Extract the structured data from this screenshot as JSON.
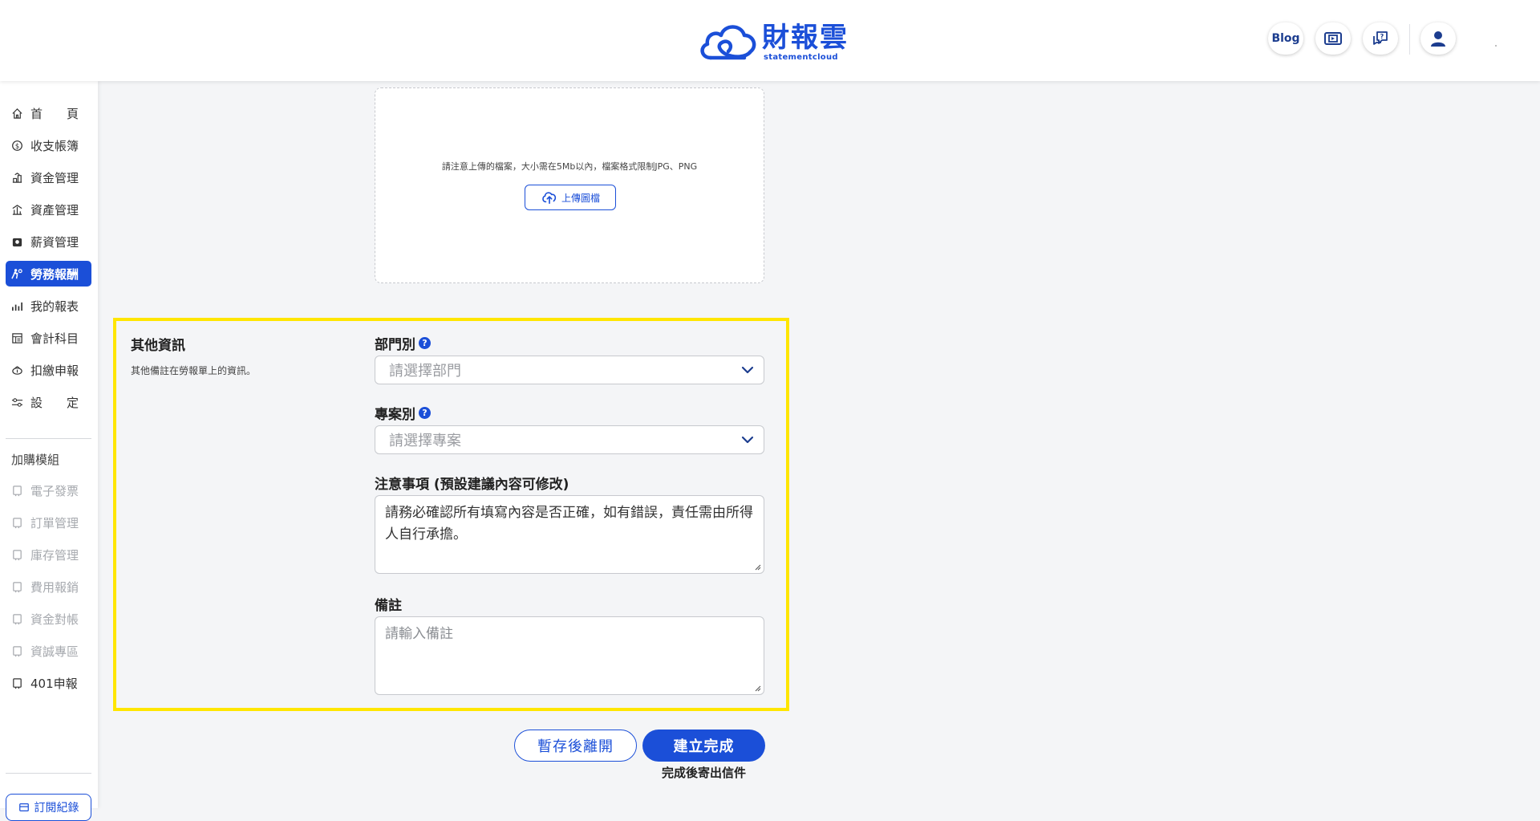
{
  "header": {
    "logo_text": "財報雲",
    "logo_sub": "statementcloud",
    "blog_label": "Blog",
    "icons": [
      "video-guide-icon",
      "help-chat-icon",
      "user-icon"
    ]
  },
  "sidebar": {
    "items": [
      {
        "label": "首　　頁",
        "icon": "home-icon"
      },
      {
        "label": "收支帳簿",
        "icon": "coin-icon"
      },
      {
        "label": "資金管理",
        "icon": "fund-icon"
      },
      {
        "label": "資產管理",
        "icon": "asset-icon"
      },
      {
        "label": "薪資管理",
        "icon": "payroll-icon"
      },
      {
        "label": "勞務報酬",
        "icon": "labor-icon",
        "active": true
      },
      {
        "label": "我的報表",
        "icon": "report-icon"
      },
      {
        "label": "會計科目",
        "icon": "ledger-icon"
      },
      {
        "label": "扣繳申報",
        "icon": "tax-icon"
      },
      {
        "label": "設　　定",
        "icon": "settings-icon"
      }
    ],
    "addon_section_label": "加購模組",
    "addons": [
      {
        "label": "電子發票",
        "icon": "module-icon",
        "disabled": true
      },
      {
        "label": "訂單管理",
        "icon": "module-icon",
        "disabled": true
      },
      {
        "label": "庫存管理",
        "icon": "module-icon",
        "disabled": true
      },
      {
        "label": "費用報銷",
        "icon": "module-icon",
        "disabled": true
      },
      {
        "label": "資金對帳",
        "icon": "module-icon",
        "disabled": true
      },
      {
        "label": "資誠專區",
        "icon": "module-icon",
        "disabled": true
      },
      {
        "label": "401申報",
        "icon": "module-icon",
        "disabled": false
      }
    ],
    "bottom_button": "訂閱紀錄"
  },
  "upload": {
    "note": "請注意上傳的檔案，大小需在5Mb以內，檔案格式限制JPG、PNG",
    "button_label": "上傳圖檔"
  },
  "other_info": {
    "title": "其他資訊",
    "description": "其他備註在勞報單上的資訊。",
    "department": {
      "label": "部門別",
      "placeholder": "請選擇部門"
    },
    "project": {
      "label": "專案別",
      "placeholder": "請選擇專案"
    },
    "notice": {
      "label": "注意事項 (預設建議內容可修改)",
      "value": "請務必確認所有填寫內容是否正確，如有錯誤，責任需由所得人自行承擔。"
    },
    "remark": {
      "label": "備註",
      "placeholder": "請輸入備註"
    }
  },
  "actions": {
    "save_draft": "暫存後離開",
    "submit": "建立完成",
    "submit_hint": "完成後寄出信件"
  },
  "colors": {
    "primary": "#1b4fd8",
    "highlight": "#ffe600"
  }
}
